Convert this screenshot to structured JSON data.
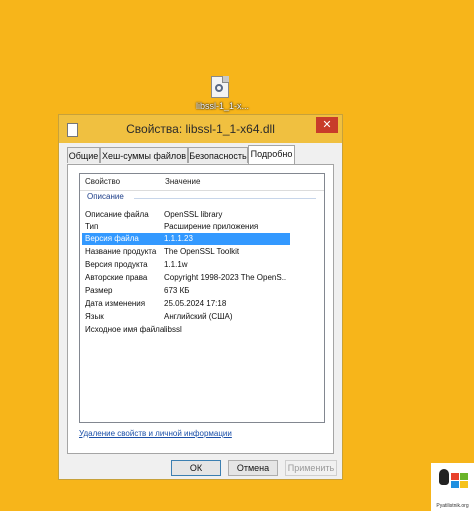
{
  "desktop_icon": {
    "label": "libssl-1_1-x..."
  },
  "dialog": {
    "title": "Свойства: libssl-1_1-x64.dll",
    "close": "✕",
    "tabs": [
      "Общие",
      "Хеш-суммы файлов",
      "Безопасность",
      "Подробно"
    ],
    "active_tab": "Подробно",
    "columns": {
      "property": "Свойство",
      "value": "Значение"
    },
    "group": "Описание",
    "rows": [
      {
        "property": "Описание файла",
        "value": "OpenSSL library"
      },
      {
        "property": "Тип",
        "value": "Расширение приложения"
      },
      {
        "property": "Версия файла",
        "value": "1.1.1.23"
      },
      {
        "property": "Название продукта",
        "value": "The OpenSSL Toolkit"
      },
      {
        "property": "Версия продукта",
        "value": "1.1.1w"
      },
      {
        "property": "Авторские права",
        "value": "Copyright 1998-2023 The OpenS..."
      },
      {
        "property": "Размер",
        "value": "673 КБ"
      },
      {
        "property": "Дата изменения",
        "value": "25.05.2024 17:18"
      },
      {
        "property": "Язык",
        "value": "Английский (США)"
      },
      {
        "property": "Исходное имя файла",
        "value": "libssl"
      }
    ],
    "selected_row": "Версия файла",
    "remove_link": "Удаление свойств и личной информации",
    "buttons": {
      "ok": "ОК",
      "cancel": "Отмена",
      "apply": "Применить"
    }
  },
  "watermark": {
    "text": "Pyatilistnik.org"
  },
  "colors": {
    "desktop": "#f7b51a",
    "titlebar": "#f0c040",
    "selection": "#3399ff",
    "close": "#c83c2a"
  }
}
